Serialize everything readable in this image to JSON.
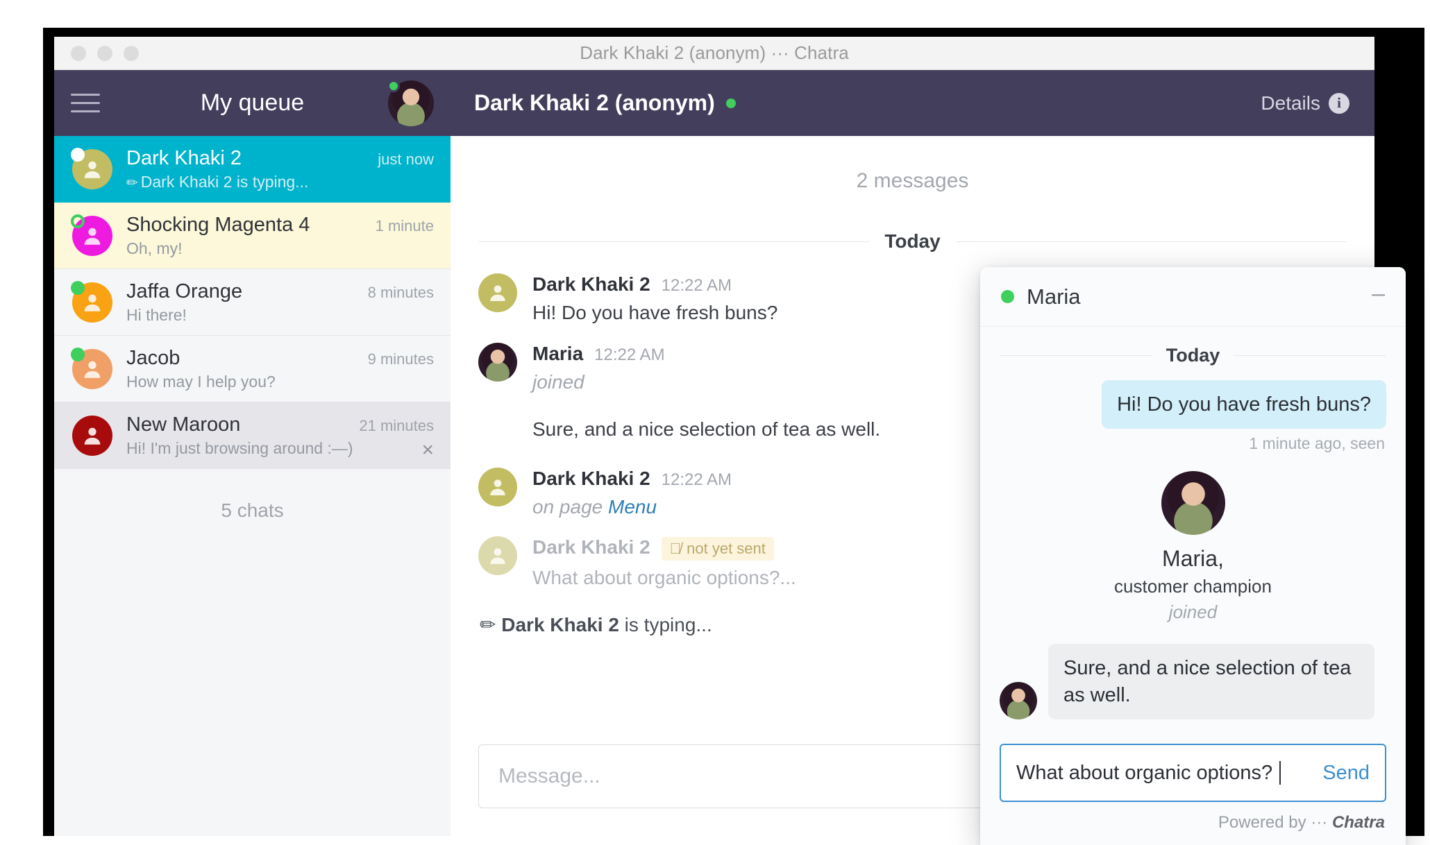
{
  "window": {
    "title": "Dark Khaki 2 (anonym) ··· Chatra",
    "traffic_lights": [
      "close",
      "minimize",
      "zoom"
    ]
  },
  "sidebar": {
    "menu_icon": "hamburger-icon",
    "queue_title": "My queue",
    "agent_avatar_name": "Maria",
    "chats_count_label": "5 chats",
    "items": [
      {
        "name": "Dark Khaki 2",
        "time": "just now",
        "snippet": "Dark Khaki 2 is typing...",
        "typing": true,
        "state": "active",
        "avatar_color": "#c2bd62",
        "badge": "white"
      },
      {
        "name": "Shocking Magenta 4",
        "time": "1 minute",
        "snippet": "Oh, my!",
        "typing": false,
        "state": "unread",
        "avatar_color": "#ef1ae0",
        "badge": "ring"
      },
      {
        "name": "Jaffa Orange",
        "time": "8 minutes",
        "snippet": "Hi there!",
        "typing": false,
        "state": "normal",
        "avatar_color": "#f9a213",
        "badge": "green"
      },
      {
        "name": "Jacob",
        "time": "9 minutes",
        "snippet": "How may I help you?",
        "typing": false,
        "state": "normal",
        "avatar_color": "#f0a066",
        "badge": "green"
      },
      {
        "name": "New Maroon",
        "time": "21 minutes",
        "snippet": "Hi! I'm just browsing around :—)",
        "typing": false,
        "state": "hovered",
        "avatar_color": "#a80b0b",
        "badge": "none",
        "close_label": "×"
      }
    ]
  },
  "main": {
    "title": "Dark Khaki 2 (anonym)",
    "online": true,
    "details_label": "Details",
    "details_icon": "info-icon",
    "message_count": "2 messages",
    "day_separator": "Today",
    "messages": [
      {
        "author": "Dark Khaki 2",
        "time": "12:22 AM",
        "text": "Hi! Do you have fresh buns?",
        "avatar_color": "#c2bd62",
        "kind": "text"
      },
      {
        "author": "Maria",
        "time": "12:22 AM",
        "event": "joined",
        "text": "Sure, and a nice selection of tea as well.",
        "avatar_color": "photo",
        "kind": "joined"
      },
      {
        "author": "Dark Khaki 2",
        "time": "12:22 AM",
        "page_prefix": "on page",
        "page_link": "Menu",
        "avatar_color": "#c2bd62",
        "kind": "page"
      },
      {
        "author": "Dark Khaki 2",
        "badge": "not yet sent",
        "badge_icon": "eye-slash-icon",
        "text": "What about organic options?...",
        "avatar_color": "#dcd9ad",
        "kind": "pending"
      }
    ],
    "typing_indicator": {
      "icon": "pencil-icon",
      "who": "Dark Khaki 2",
      "suffix": "is typing..."
    },
    "composer_placeholder": "Message..."
  },
  "widget": {
    "agent_name": "Maria",
    "online": true,
    "minimize_label": "–",
    "day_separator": "Today",
    "visitor_message": "Hi! Do you have fresh buns?",
    "visitor_meta": "1 minute ago, seen",
    "intro": {
      "name": "Maria,",
      "role": "customer champion",
      "event": "joined"
    },
    "agent_message": "Sure, and a nice selection of tea as well.",
    "input_value": "What about organic options?",
    "send_label": "Send",
    "footer_prefix": "Powered by ···",
    "footer_brand": "Chatra"
  },
  "colors": {
    "navy": "#443e5d",
    "cyan": "#00b3cc",
    "green": "#3ecf5e",
    "link_blue": "#2c7fb8",
    "widget_blue": "#3d8fd1"
  }
}
